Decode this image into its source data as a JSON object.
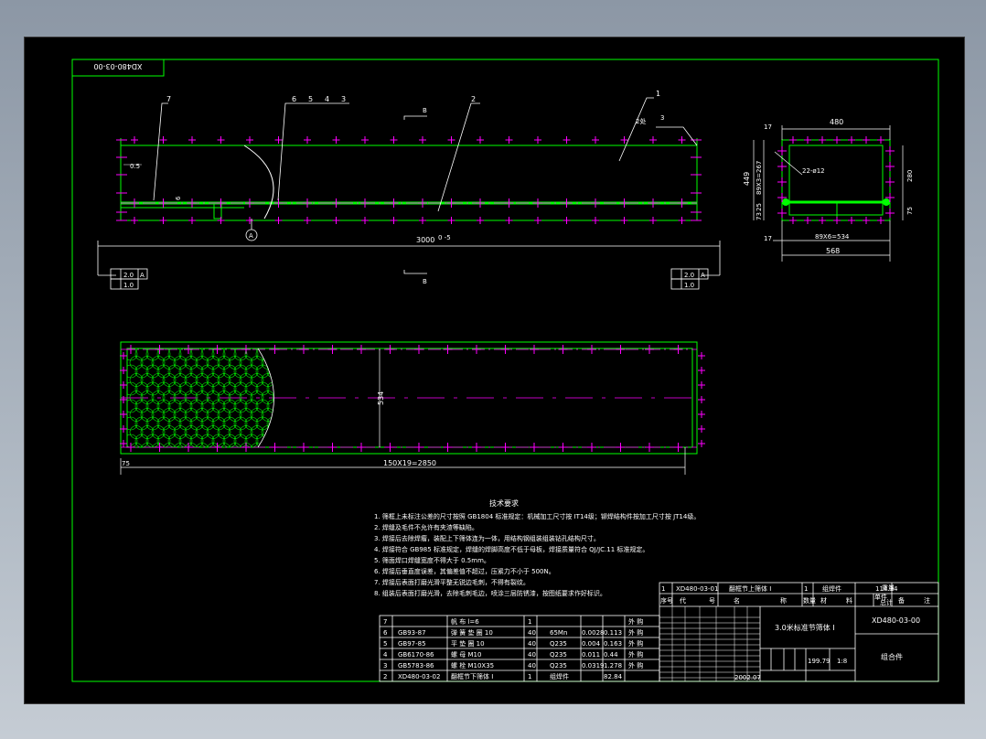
{
  "drawing_no_rotated": "XD480-03-00",
  "front_view": {
    "leaders": [
      "7",
      "6",
      "5",
      "4",
      "3",
      "2",
      "1"
    ],
    "section_mark": "B",
    "dim_left": "0.5",
    "dim_vertical": "6",
    "overall_length": "3000",
    "overall_tol": "0 -5",
    "weld_note": "2处",
    "weld_sym": "3",
    "detail_mark": "A",
    "tol_flat": "2.0",
    "tol_datum": "A",
    "tol_parallel": "1.0"
  },
  "side_view": {
    "width_top": "480",
    "height_total": "449",
    "height_right": "280",
    "top_offset": "17",
    "v_pitch": "89X3=267",
    "dim_75a": "75",
    "dim_73": "73",
    "dim_25": "25",
    "holes": "22-ø12",
    "bottom_offset": "17",
    "bottom_pitch": "89X6=534",
    "bottom_width": "568"
  },
  "plan_view": {
    "width_dim": "534",
    "left_offset": "75",
    "pitch": "150X19=2850"
  },
  "tech_requirements": {
    "title": "技术要求",
    "items": [
      "1. 筛框上未标注公差的尺寸按照 GB1804 标准规定：机械加工尺寸按 IT14级；铆焊结构件按加工尺寸按 JT14级。",
      "2. 焊缝及毛件不允许有夹渣等缺陷。",
      "3. 焊接后去除焊瘤，装配上下筛体连为一体，用结构钢组装组装钻孔结构尺寸。",
      "4. 焊接符合 GB985 标准规定，焊缝的焊脚高度不低于母板，焊接质量符合 QJ/JC.11 标准规定。",
      "5. 筛面焊口焊缝宽度不得大于 0.5mm。",
      "6. 焊接后垂直度误差，其偏差值不超过，压紧力不小于 500N。",
      "7. 焊接后表面打磨光滑平整无锐边毛刺，不得有裂纹。",
      "8. 组装后表面打磨光滑，去除毛刺毛边，喷涂三层防锈漆，按图纸要求作好标识。"
    ]
  },
  "parts_list": {
    "rows": [
      {
        "no": "7",
        "code": "",
        "name": "帆  布  l=6",
        "qty": "1",
        "mat": "",
        "w1": "",
        "w2": "",
        "note": "外  购"
      },
      {
        "no": "6",
        "code": "GB93-87",
        "name": "弹  簧  垫  圈   10",
        "qty": "40",
        "mat": "65Mn",
        "w1": "0.0028",
        "w2": "0.113",
        "note": "外  购"
      },
      {
        "no": "5",
        "code": "GB97-85",
        "name": "平  垫  圈   10",
        "qty": "40",
        "mat": "Q235",
        "w1": "0.004",
        "w2": "0.163",
        "note": "外  购"
      },
      {
        "no": "4",
        "code": "GB6170-86",
        "name": "螺  母   M10",
        "qty": "40",
        "mat": "Q235",
        "w1": "0.011",
        "w2": "0.44",
        "note": "外  购"
      },
      {
        "no": "3",
        "code": "GB5783-86",
        "name": "螺  栓   M10X35",
        "qty": "40",
        "mat": "Q235",
        "w1": "0.0319",
        "w2": "1.278",
        "note": "外  购"
      },
      {
        "no": "2",
        "code": "XD480-03-02",
        "name": "翻框节下筛体 I",
        "qty": "1",
        "mat": "组焊件",
        "w1": "",
        "w2": "82.84",
        "note": ""
      }
    ]
  },
  "title_block": {
    "row1": {
      "no": "1",
      "code": "XD480-03-01",
      "name": "翻框节上筛体 I",
      "qty": "1",
      "mat": "组焊件",
      "w2": "114.34"
    },
    "headers": [
      "序号",
      "代",
      "号",
      "名",
      "称",
      "数量",
      "材",
      "料",
      "单件",
      "总计",
      "备",
      "注"
    ],
    "headers_weight": "重量",
    "product": "3.0米标准节筛体 I",
    "drawing_no": "XD480-03-00",
    "type": "组合件",
    "mass": "199.79",
    "scale": "1:8",
    "date": "2002.07"
  },
  "colors": {
    "green": "#00ff00",
    "magenta": "#ff00ff",
    "white": "#ffffff",
    "cyan": "#00ffff",
    "yellow": "#ffff00",
    "red": "#ff2020"
  }
}
